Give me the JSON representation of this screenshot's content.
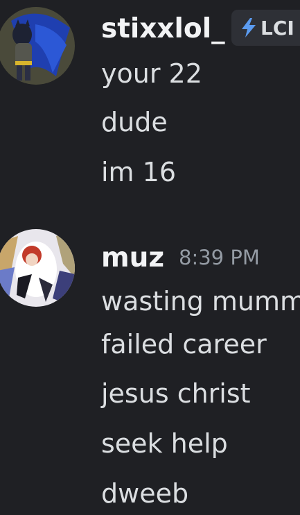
{
  "messages": [
    {
      "username": "stixxlol_",
      "tag": "LCI",
      "tag_icon": "lightning-bolt-icon",
      "lines": [
        "your 22",
        "dude",
        "im 16"
      ]
    },
    {
      "username": "muz",
      "timestamp": "8:39 PM",
      "lines": [
        "wasting mumm",
        "failed career",
        "jesus christ",
        "seek help",
        "dweeb"
      ]
    }
  ],
  "colors": {
    "background": "#1f2024",
    "username": "#f2f3f5",
    "message_text": "#dbdee1",
    "timestamp": "#949ba4",
    "tag_bg": "#2e3036",
    "tag_icon": "#5b9bf0"
  }
}
